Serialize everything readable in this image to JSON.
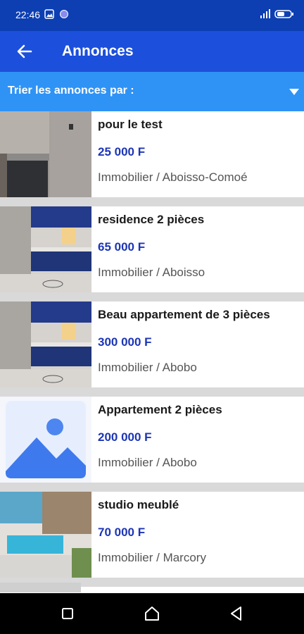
{
  "status": {
    "time": "22:46"
  },
  "header": {
    "title": "Annonces"
  },
  "sort": {
    "label": "Trier les annonces par :"
  },
  "listings": [
    {
      "title": "pour le test",
      "price": "25 000 F",
      "category": "Immobilier / Aboisso-Comoé"
    },
    {
      "title": "residence 2 pièces",
      "price": "65 000 F",
      "category": "Immobilier / Aboisso"
    },
    {
      "title": "Beau appartement de 3 pièces",
      "price": "300 000 F",
      "category": "Immobilier / Abobo"
    },
    {
      "title": "Appartement 2 pièces",
      "price": "200 000 F",
      "category": "Immobilier / Abobo"
    },
    {
      "title": "studio meublé",
      "price": "70 000 F",
      "category": "Immobilier / Marcory"
    }
  ]
}
